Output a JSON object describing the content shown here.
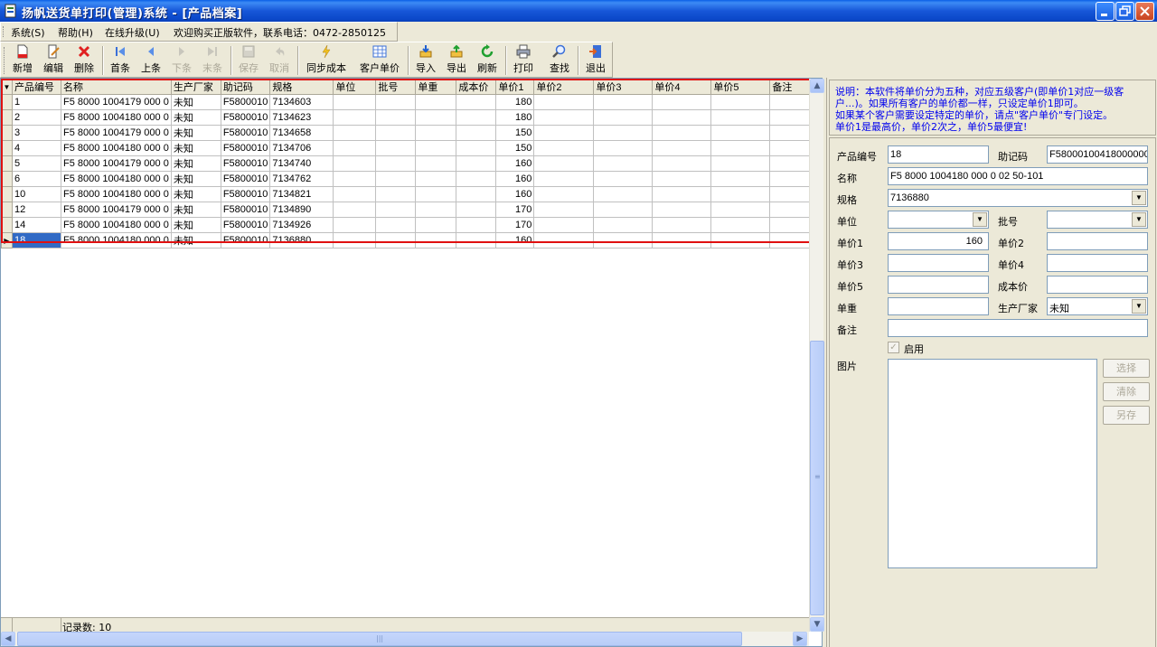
{
  "window": {
    "title": "扬帆送货单打印(管理)系统 - [产品档案]"
  },
  "menu": {
    "items": [
      "系统(S)",
      "帮助(H)",
      "在线升级(U)",
      "欢迎购买正版软件，联系电话：0472-2850125"
    ]
  },
  "toolbar": {
    "new": "新增",
    "edit": "编辑",
    "delete": "删除",
    "first": "首条",
    "prev": "上条",
    "next": "下条",
    "last": "末条",
    "save": "保存",
    "cancel": "取消",
    "sync_cost": "同步成本",
    "customer_price": "客户单价",
    "import": "导入",
    "export": "导出",
    "refresh": "刷新",
    "print": "打印",
    "find": "查找",
    "exit": "退出"
  },
  "grid": {
    "columns": [
      "产品编号",
      "名称",
      "生产厂家",
      "助记码",
      "规格",
      "单位",
      "批号",
      "单重",
      "成本价",
      "单价1",
      "单价2",
      "单价3",
      "单价4",
      "单价5",
      "备注"
    ],
    "rows": [
      {
        "code": "1",
        "name": "F5 8000 1004179 000 0",
        "maker": "未知",
        "mnemonic": "F5800010",
        "spec": "7134603",
        "price1": "180"
      },
      {
        "code": "2",
        "name": "F5 8000 1004180 000 0",
        "maker": "未知",
        "mnemonic": "F5800010",
        "spec": "7134623",
        "price1": "180"
      },
      {
        "code": "3",
        "name": "F5 8000 1004179 000 0",
        "maker": "未知",
        "mnemonic": "F5800010",
        "spec": "7134658",
        "price1": "150"
      },
      {
        "code": "4",
        "name": "F5 8000 1004180 000 0",
        "maker": "未知",
        "mnemonic": "F5800010",
        "spec": "7134706",
        "price1": "150"
      },
      {
        "code": "5",
        "name": "F5 8000 1004179 000 0",
        "maker": "未知",
        "mnemonic": "F5800010",
        "spec": "7134740",
        "price1": "160"
      },
      {
        "code": "6",
        "name": "F5 8000 1004180 000 0",
        "maker": "未知",
        "mnemonic": "F5800010",
        "spec": "7134762",
        "price1": "160"
      },
      {
        "code": "10",
        "name": "F5 8000 1004180 000 0",
        "maker": "未知",
        "mnemonic": "F5800010",
        "spec": "7134821",
        "price1": "160"
      },
      {
        "code": "12",
        "name": "F5 8000 1004179 000 0",
        "maker": "未知",
        "mnemonic": "F5800010",
        "spec": "7134890",
        "price1": "170"
      },
      {
        "code": "14",
        "name": "F5 8000 1004180 000 0",
        "maker": "未知",
        "mnemonic": "F5800010",
        "spec": "7134926",
        "price1": "170"
      },
      {
        "code": "18",
        "name": "F5 8000 1004180 000 0",
        "maker": "未知",
        "mnemonic": "F5800010",
        "spec": "7136880",
        "price1": "160"
      }
    ],
    "selected_index": 9,
    "record_count": "记录数: 10"
  },
  "info": {
    "lines": [
      "说明：本软件将单价分为五种，对应五级客户(即单价1对应一级客户...)。如果所有客户的单价都一样，只设定单价1即可。",
      "如果某个客户需要设定特定的单价，请点\"客户单价\"专门设定。",
      "单价1是最高价，单价2次之，单价5最便宜!"
    ]
  },
  "form": {
    "labels": {
      "code": "产品编号",
      "mnemonic": "助记码",
      "name": "名称",
      "spec": "规格",
      "unit": "单位",
      "batch": "批号",
      "price1": "单价1",
      "price2": "单价2",
      "price3": "单价3",
      "price4": "单价4",
      "price5": "单价5",
      "cost": "成本价",
      "weight": "单重",
      "maker": "生产厂家",
      "remark": "备注",
      "enabled": "启用",
      "picture": "图片"
    },
    "values": {
      "code": "18",
      "mnemonic": "F58000100418000000",
      "name": "F5 8000 1004180 000 0 02 50-101",
      "spec": "7136880",
      "unit": "",
      "batch": "",
      "price1": "160",
      "price2": "",
      "price3": "",
      "price4": "",
      "price5": "",
      "cost": "",
      "weight": "",
      "maker": "未知",
      "remark": ""
    },
    "buttons": {
      "select": "选择",
      "clear": "清除",
      "save_as": "另存"
    }
  }
}
